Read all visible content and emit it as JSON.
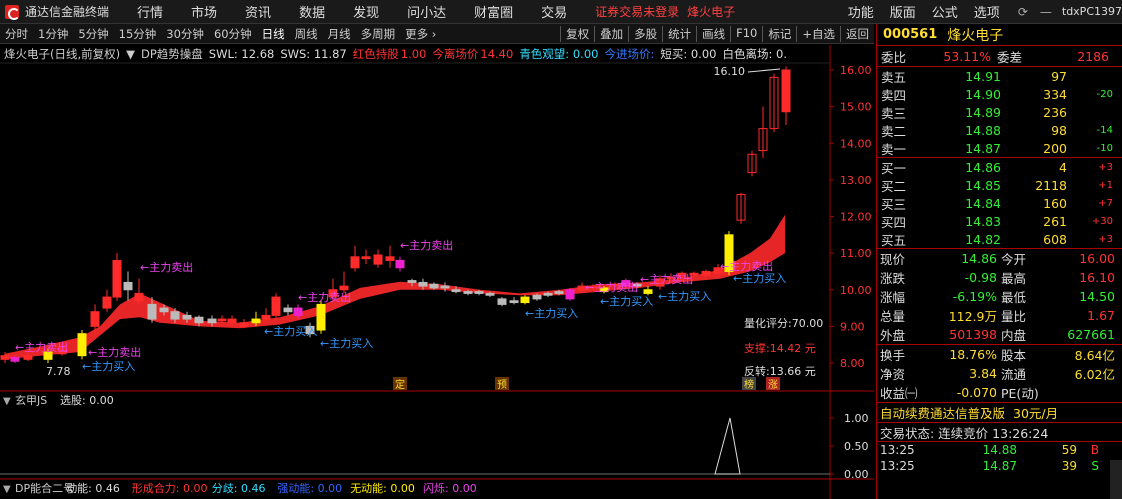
{
  "app": {
    "title": "通达信金融终端",
    "menu": [
      "行情",
      "市场",
      "资讯",
      "数据",
      "发现",
      "问小达",
      "财富圈",
      "交易"
    ],
    "login_status": "证券交易未登录",
    "stock_name": "烽火电子",
    "right_menu": [
      "功能",
      "版面",
      "公式",
      "选项"
    ],
    "user_id": "tdxPC1397"
  },
  "toolbar": {
    "periods": [
      "分时",
      "1分钟",
      "5分钟",
      "15分钟",
      "30分钟",
      "60分钟",
      "日线",
      "周线",
      "月线",
      "多周期",
      "更多 ›"
    ],
    "active_period": "日线",
    "right_buttons": [
      "复权",
      "叠加",
      "多股",
      "统计",
      "画线",
      "F10",
      "标记",
      "+自选",
      "返回"
    ]
  },
  "chart_info": {
    "name": "烽火电子(日线,前复权)",
    "indicator": "DP趋势操盘",
    "swl": "SWL: 12.68",
    "sws": "SWS: 11.87",
    "red_hold_label": "红色持股",
    "red_hold_value": "1.00",
    "exit_price_label": "今离场价",
    "exit_price_value": "14.40",
    "cyan_watch": "青色观望: 0.00",
    "entry_price": "今进场价:",
    "short_buy": "短买: 0.00",
    "white_exit": "白色离场: 0."
  },
  "annotations": {
    "main_sell": "←主力卖出",
    "main_buy": "←主力买入",
    "high_label": "16.10",
    "low_label": "7.78",
    "quant_score": "量化评分:70.00",
    "support": "支撑:14.42 元",
    "reverse": "反转:13.66 元",
    "tags": [
      "定",
      "预",
      "榜",
      "涨"
    ]
  },
  "chart_data": [
    {
      "type": "candlestick",
      "title": "烽火电子(日线,前复权)",
      "ylim": [
        7.7,
        16.3
      ],
      "yticks": [
        "16.00",
        "15.00",
        "14.00",
        "13.00",
        "12.00",
        "11.00",
        "10.00",
        "9.00",
        "8.00"
      ],
      "high": 16.1,
      "low": 7.78,
      "last_close": 14.86
    },
    {
      "type": "line",
      "title": "玄甲JS",
      "select_label": "选股: 0.00",
      "yticks": [
        "1.00",
        "0.50",
        "0.00"
      ],
      "ylim": [
        0,
        1
      ],
      "spike_value": 1.0
    },
    {
      "type": "bar",
      "title": "DP能合二号",
      "values_text": {
        "kinetic": "动能: 0.46",
        "form_force": "形成合力: 0.00",
        "divergence": "分歧: 0.46",
        "gather": "强动能: 0.00",
        "no_power": "无动能: 0.00",
        "flash": "闪烁: 0.00"
      }
    }
  ],
  "quote": {
    "code": "000561",
    "name": "烽火电子",
    "wei_bi_label": "委比",
    "wei_bi": "53.11%",
    "wei_cha_label": "委差",
    "wei_cha": "2186",
    "asks": [
      {
        "label": "卖五",
        "price": "14.91",
        "vol": "97",
        "chg": ""
      },
      {
        "label": "卖四",
        "price": "14.90",
        "vol": "334",
        "chg": "-20"
      },
      {
        "label": "卖三",
        "price": "14.89",
        "vol": "236",
        "chg": ""
      },
      {
        "label": "卖二",
        "price": "14.88",
        "vol": "98",
        "chg": "-14"
      },
      {
        "label": "卖一",
        "price": "14.87",
        "vol": "200",
        "chg": "-10"
      }
    ],
    "bids": [
      {
        "label": "买一",
        "price": "14.86",
        "vol": "4",
        "chg": "+3"
      },
      {
        "label": "买二",
        "price": "14.85",
        "vol": "2118",
        "chg": "+1"
      },
      {
        "label": "买三",
        "price": "14.84",
        "vol": "160",
        "chg": "+7"
      },
      {
        "label": "买四",
        "price": "14.83",
        "vol": "261",
        "chg": "+30"
      },
      {
        "label": "买五",
        "price": "14.82",
        "vol": "608",
        "chg": "+3"
      }
    ],
    "stats": [
      {
        "l1": "现价",
        "v1": "14.86",
        "c1": "green",
        "l2": "今开",
        "v2": "16.00",
        "c2": "red"
      },
      {
        "l1": "涨跌",
        "v1": "-0.98",
        "c1": "green",
        "l2": "最高",
        "v2": "16.10",
        "c2": "red"
      },
      {
        "l1": "涨幅",
        "v1": "-6.19%",
        "c1": "green",
        "l2": "最低",
        "v2": "14.50",
        "c2": "green"
      },
      {
        "l1": "总量",
        "v1": "112.9万",
        "c1": "yellow",
        "l2": "量比",
        "v2": "1.67",
        "c2": "red"
      },
      {
        "l1": "外盘",
        "v1": "501398",
        "c1": "red",
        "l2": "内盘",
        "v2": "627661",
        "c2": "green"
      }
    ],
    "stats2": [
      {
        "l1": "换手",
        "v1": "18.76%",
        "l2": "股本",
        "v2": "8.64亿"
      },
      {
        "l1": "净资",
        "v1": "3.84",
        "l2": "流通",
        "v2": "6.02亿"
      },
      {
        "l1": "收益㈠",
        "v1": "-0.070",
        "l2": "PE(动)",
        "v2": ""
      }
    ],
    "promo": "自动续费通达信普及版",
    "promo_price": "30元/月",
    "trade_state": "交易状态: 连续竞价 13:26:24",
    "ticks": [
      {
        "time": "13:25",
        "price": "14.88",
        "vol": "59",
        "side": "B"
      },
      {
        "time": "13:25",
        "price": "14.87",
        "vol": "39",
        "side": "S"
      }
    ]
  }
}
